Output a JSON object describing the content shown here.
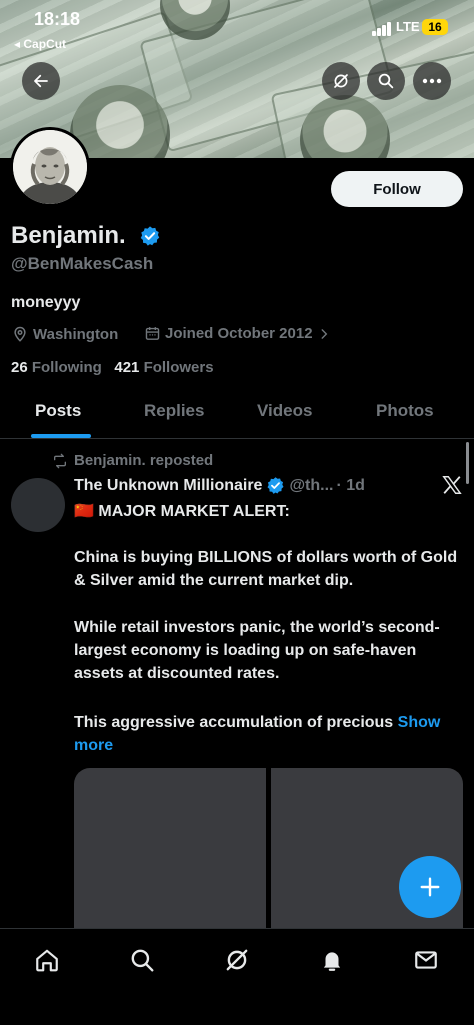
{
  "status_bar": {
    "time": "18:18",
    "back_app": "◂ CapCut",
    "network": "LTE",
    "battery": "16"
  },
  "header": {
    "back_icon": "arrow-left-icon",
    "grok_icon": "grok-icon",
    "search_icon": "search-icon",
    "more_icon": "more-icon"
  },
  "profile": {
    "name": "Benjamin.",
    "handle": "@BenMakesCash",
    "bio": "moneyyy",
    "location": "Washington",
    "joined": "Joined October 2012",
    "follow_label": "Follow",
    "following_count": "26",
    "following_label": "Following",
    "followers_count": "421",
    "followers_label": "Followers"
  },
  "tabs": [
    {
      "label": "Posts",
      "active": true
    },
    {
      "label": "Replies",
      "active": false
    },
    {
      "label": "Videos",
      "active": false
    },
    {
      "label": "Photos",
      "active": false
    }
  ],
  "post": {
    "repost_label": "Benjamin. reposted",
    "author": "The Unknown Millionaire",
    "handle": "@th...",
    "time": "· 1d",
    "line1": "🇨🇳 MAJOR MARKET ALERT:",
    "para1": "China is buying BILLIONS of dollars worth of Gold & Silver amid the current market dip.",
    "para2": "While retail investors panic, the world’s second-largest economy is loading up on safe-haven assets at discounted rates.",
    "para3": "This aggressive accumulation of precious",
    "show_more": "Show more"
  },
  "colors": {
    "accent": "#1d9bf0",
    "muted": "#71767b",
    "text": "#e7e9ea",
    "background": "#000000"
  },
  "bottom_nav": [
    "home-icon",
    "search-icon",
    "grok-icon",
    "notifications-icon",
    "messages-icon"
  ]
}
